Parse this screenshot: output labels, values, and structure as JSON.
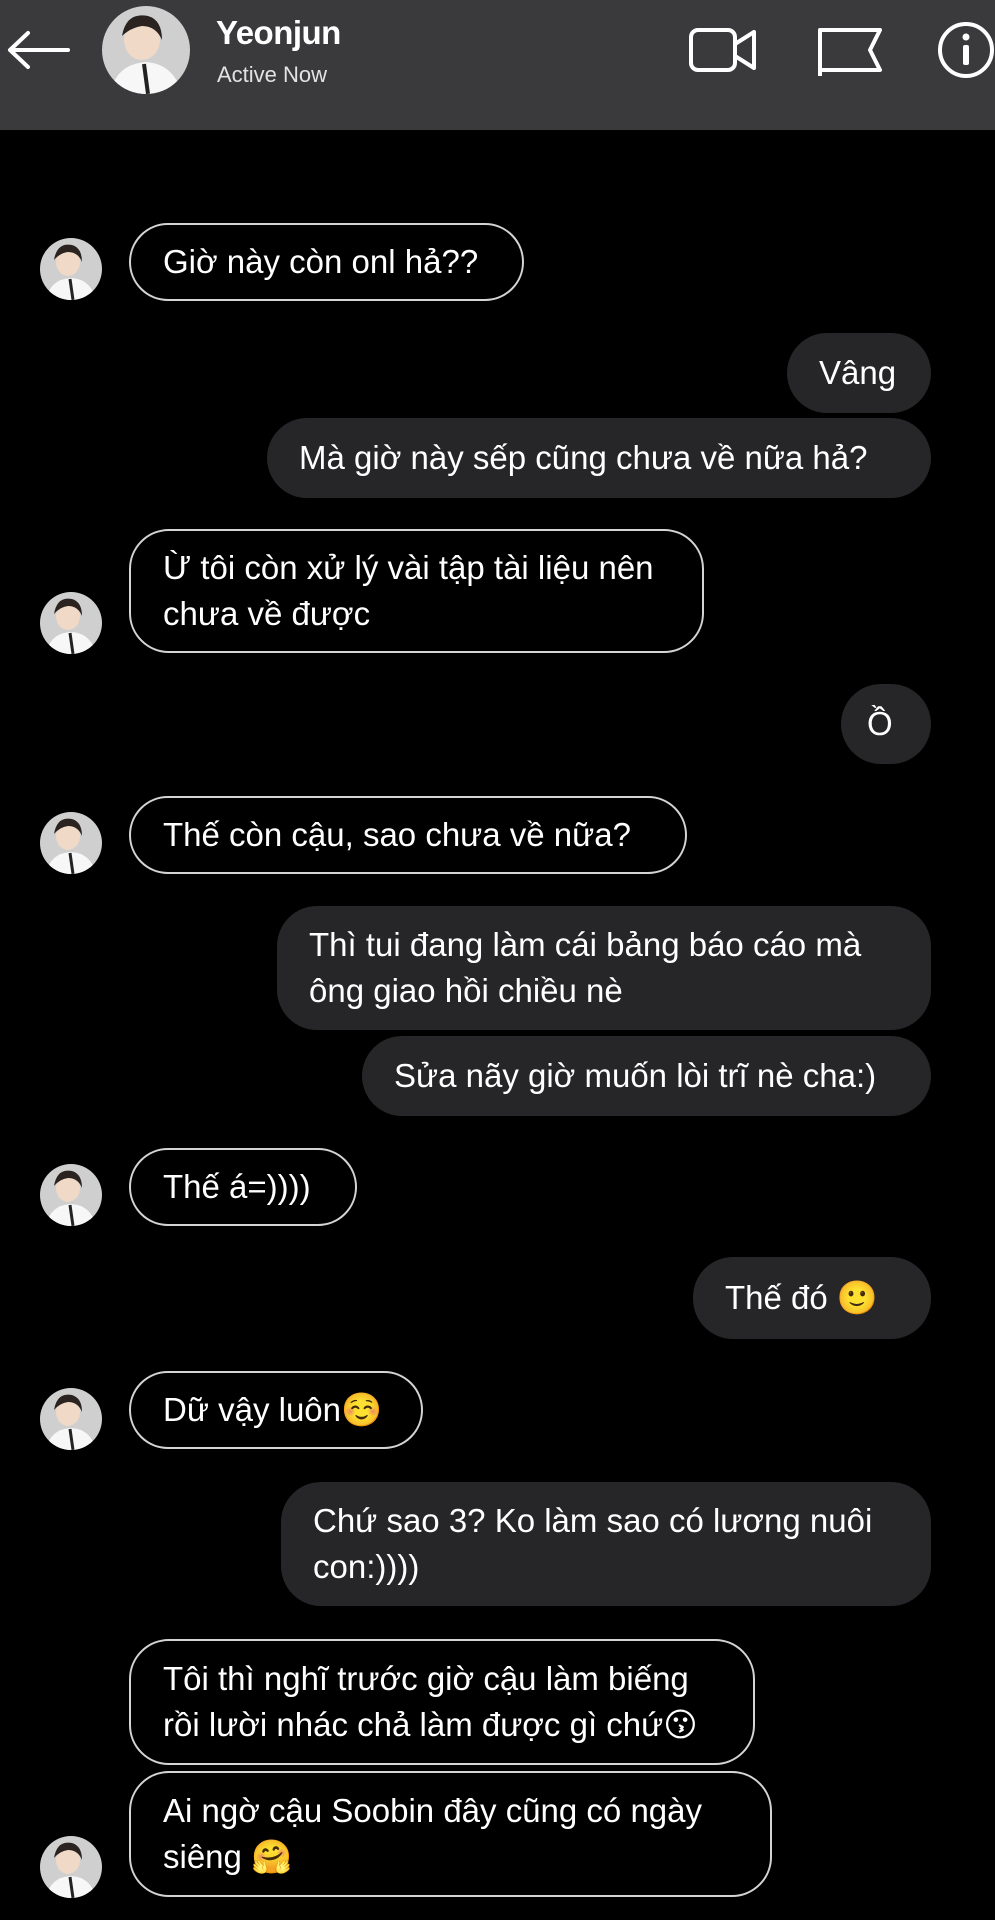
{
  "header": {
    "name": "Yeonjun",
    "status": "Active Now"
  },
  "icons": {
    "back": "arrow-left-icon",
    "video": "video-camera-icon",
    "flag": "flag-icon",
    "info": "info-icon"
  },
  "messages": [
    {
      "side": "in",
      "text": "Giờ này còn onl hả??"
    },
    {
      "side": "out",
      "text": "Vâng"
    },
    {
      "side": "out",
      "text": "Mà giờ này sếp cũng chưa về nữa hả?"
    },
    {
      "side": "in",
      "text": "Ừ tôi còn xử lý vài tập tài liệu nên\nchưa về được"
    },
    {
      "side": "out",
      "text": "Ồ"
    },
    {
      "side": "in",
      "text": "Thế còn cậu, sao chưa về nữa?"
    },
    {
      "side": "out",
      "text": "Thì tui đang làm cái bảng báo cáo mà\nông giao hồi chiều nè"
    },
    {
      "side": "out",
      "text": "Sửa nãy giờ muốn lòi trĩ nè cha:)"
    },
    {
      "side": "in",
      "text": "Thế á=))))"
    },
    {
      "side": "out",
      "text": "Thế đó 🙂"
    },
    {
      "side": "in",
      "text": "Dữ vậy luôn☺️"
    },
    {
      "side": "out",
      "text": "Chứ sao 3? Ko làm sao có lương nuôi\ncon:))))"
    },
    {
      "side": "in",
      "text": "Tôi thì nghĩ trước giờ cậu làm biếng\nrồi lười nhác chả làm được gì chứ😗"
    },
    {
      "side": "in",
      "text": "Ai ngờ cậu Soobin đây cũng có ngày\nsiêng 🤗"
    }
  ],
  "colors": {
    "header_bg": "#3a3a3c",
    "outgoing_bubble": "#262629",
    "incoming_border": "#d4d4d4",
    "background": "#000000"
  }
}
